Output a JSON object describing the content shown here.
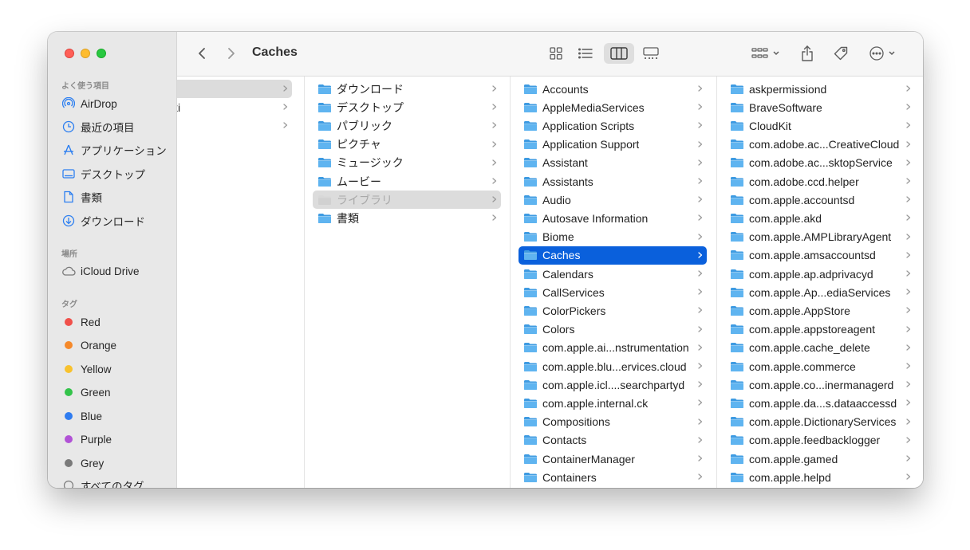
{
  "window": {
    "title": "Caches"
  },
  "sidebar": {
    "favorites_heading": "よく使う項目",
    "favorites": [
      {
        "label": "AirDrop",
        "icon": "airdrop-icon"
      },
      {
        "label": "最近の項目",
        "icon": "clock-icon"
      },
      {
        "label": "アプリケーション",
        "icon": "applications-icon"
      },
      {
        "label": "デスクトップ",
        "icon": "desktop-icon"
      },
      {
        "label": "書類",
        "icon": "document-icon"
      },
      {
        "label": "ダウンロード",
        "icon": "download-icon"
      }
    ],
    "locations_heading": "場所",
    "locations": [
      {
        "label": "iCloud Drive",
        "icon": "cloud-icon"
      }
    ],
    "tags_heading": "タグ",
    "tags": [
      {
        "label": "Red",
        "color": "#f0504a"
      },
      {
        "label": "Orange",
        "color": "#f5892a"
      },
      {
        "label": "Yellow",
        "color": "#f8c22e"
      },
      {
        "label": "Green",
        "color": "#33c34a"
      },
      {
        "label": "Blue",
        "color": "#2f7cf0"
      },
      {
        "label": "Purple",
        "color": "#b152d6"
      },
      {
        "label": "Grey",
        "color": "#7a7a7a"
      }
    ],
    "all_tags_label": "すべてのタグ"
  },
  "columns": {
    "col1_partial": [
      "",
      "ki",
      ""
    ],
    "col2": [
      "ダウンロード",
      "デスクトップ",
      "パブリック",
      "ピクチャ",
      "ミュージック",
      "ムービー",
      "ライブラリ",
      "書類"
    ],
    "col3": [
      "Accounts",
      "AppleMediaServices",
      "Application Scripts",
      "Application Support",
      "Assistant",
      "Assistants",
      "Audio",
      "Autosave Information",
      "Biome",
      "Caches",
      "Calendars",
      "CallServices",
      "ColorPickers",
      "Colors",
      "com.apple.ai...nstrumentation",
      "com.apple.blu...ervices.cloud",
      "com.apple.icl....searchpartyd",
      "com.apple.internal.ck",
      "Compositions",
      "Contacts",
      "ContainerManager",
      "Containers"
    ],
    "col4": [
      "askpermissiond",
      "BraveSoftware",
      "CloudKit",
      "com.adobe.ac...CreativeCloud",
      "com.adobe.ac...sktopService",
      "com.adobe.ccd.helper",
      "com.apple.accountsd",
      "com.apple.akd",
      "com.apple.AMPLibraryAgent",
      "com.apple.amsaccountsd",
      "com.apple.ap.adprivacyd",
      "com.apple.Ap...ediaServices",
      "com.apple.AppStore",
      "com.apple.appstoreagent",
      "com.apple.cache_delete",
      "com.apple.commerce",
      "com.apple.co...inermanagerd",
      "com.apple.da...s.dataaccessd",
      "com.apple.DictionaryServices",
      "com.apple.feedbacklogger",
      "com.apple.gamed",
      "com.apple.helpd"
    ]
  },
  "colors": {
    "selection": "#0a60dc",
    "folder": "#5fb4f0"
  }
}
